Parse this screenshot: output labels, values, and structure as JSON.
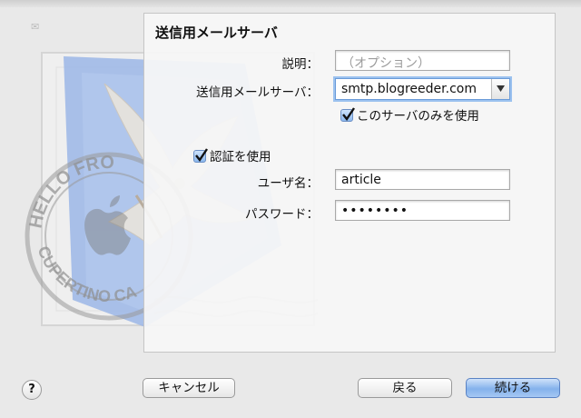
{
  "panel": {
    "title": "送信用メールサーバ"
  },
  "form": {
    "description_label": "説明：",
    "description_placeholder": "（オプション）",
    "server_label": "送信用メールサーバ：",
    "server_value": "smtp.blogreeder.com",
    "only_this_server_label": "このサーバのみを使用",
    "only_this_server_checked": true,
    "use_auth_label": "認証を使用",
    "use_auth_checked": true,
    "username_label": "ユーザ名：",
    "username_value": "article",
    "password_label": "パスワード：",
    "password_value": "••••••••"
  },
  "footer": {
    "help_label": "?",
    "cancel_label": "キャンセル",
    "back_label": "戻る",
    "continue_label": "続ける"
  },
  "stamp": {
    "text_top": "HELLO FRO",
    "text_bottom": "CUPERTINO CA"
  },
  "colors": {
    "accent": "#84b2ec",
    "stamp_blue": "#9bb6e6"
  }
}
